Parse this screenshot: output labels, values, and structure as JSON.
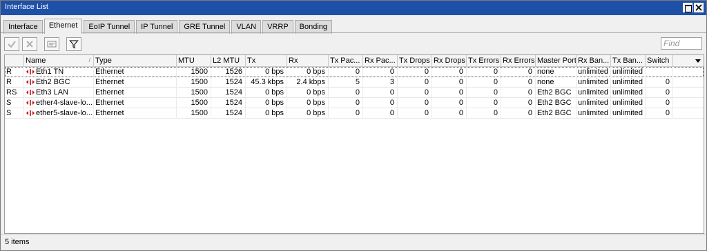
{
  "window": {
    "title": "Interface List"
  },
  "tabs": [
    {
      "label": "Interface"
    },
    {
      "label": "Ethernet"
    },
    {
      "label": "EoIP Tunnel"
    },
    {
      "label": "IP Tunnel"
    },
    {
      "label": "GRE Tunnel"
    },
    {
      "label": "VLAN"
    },
    {
      "label": "VRRP"
    },
    {
      "label": "Bonding"
    }
  ],
  "active_tab": "Ethernet",
  "toolbar": {
    "find_placeholder": "Find"
  },
  "table": {
    "columns": [
      "",
      "Name",
      "Type",
      "MTU",
      "L2 MTU",
      "Tx",
      "Rx",
      "Tx Pac...",
      "Rx Pac...",
      "Tx Drops",
      "Rx Drops",
      "Tx Errors",
      "Rx Errors",
      "Master Port",
      "Rx Ban...",
      "Tx Ban...",
      "Switch"
    ],
    "rows": [
      {
        "flag": "R",
        "name": "Eth1 TN",
        "type": "Ethernet",
        "mtu": "1500",
        "l2mtu": "1526",
        "tx": "0 bps",
        "rx": "0 bps",
        "tx_pkts": "0",
        "rx_pkts": "0",
        "tx_drops": "0",
        "rx_drops": "0",
        "tx_errors": "0",
        "rx_errors": "0",
        "master": "none",
        "rx_bw": "unlimited",
        "tx_bw": "unlimited",
        "switch": ""
      },
      {
        "flag": "R",
        "name": "Eth2 BGC",
        "type": "Ethernet",
        "mtu": "1500",
        "l2mtu": "1524",
        "tx": "45.3 kbps",
        "rx": "2.4 kbps",
        "tx_pkts": "5",
        "rx_pkts": "3",
        "tx_drops": "0",
        "rx_drops": "0",
        "tx_errors": "0",
        "rx_errors": "0",
        "master": "none",
        "rx_bw": "unlimited",
        "tx_bw": "unlimited",
        "switch": "0"
      },
      {
        "flag": "RS",
        "name": "Eth3 LAN",
        "type": "Ethernet",
        "mtu": "1500",
        "l2mtu": "1524",
        "tx": "0 bps",
        "rx": "0 bps",
        "tx_pkts": "0",
        "rx_pkts": "0",
        "tx_drops": "0",
        "rx_drops": "0",
        "tx_errors": "0",
        "rx_errors": "0",
        "master": "Eth2 BGC",
        "rx_bw": "unlimited",
        "tx_bw": "unlimited",
        "switch": "0"
      },
      {
        "flag": "S",
        "name": "ether4-slave-lo...",
        "type": "Ethernet",
        "mtu": "1500",
        "l2mtu": "1524",
        "tx": "0 bps",
        "rx": "0 bps",
        "tx_pkts": "0",
        "rx_pkts": "0",
        "tx_drops": "0",
        "rx_drops": "0",
        "tx_errors": "0",
        "rx_errors": "0",
        "master": "Eth2 BGC",
        "rx_bw": "unlimited",
        "tx_bw": "unlimited",
        "switch": "0"
      },
      {
        "flag": "S",
        "name": "ether5-slave-lo...",
        "type": "Ethernet",
        "mtu": "1500",
        "l2mtu": "1524",
        "tx": "0 bps",
        "rx": "0 bps",
        "tx_pkts": "0",
        "rx_pkts": "0",
        "tx_drops": "0",
        "rx_drops": "0",
        "tx_errors": "0",
        "rx_errors": "0",
        "master": "Eth2 BGC",
        "rx_bw": "unlimited",
        "tx_bw": "unlimited",
        "switch": "0"
      }
    ]
  },
  "status": {
    "items_text": "5 items"
  },
  "colors": {
    "titlebar": "#1f50a8",
    "icon_red": "#c01010"
  }
}
